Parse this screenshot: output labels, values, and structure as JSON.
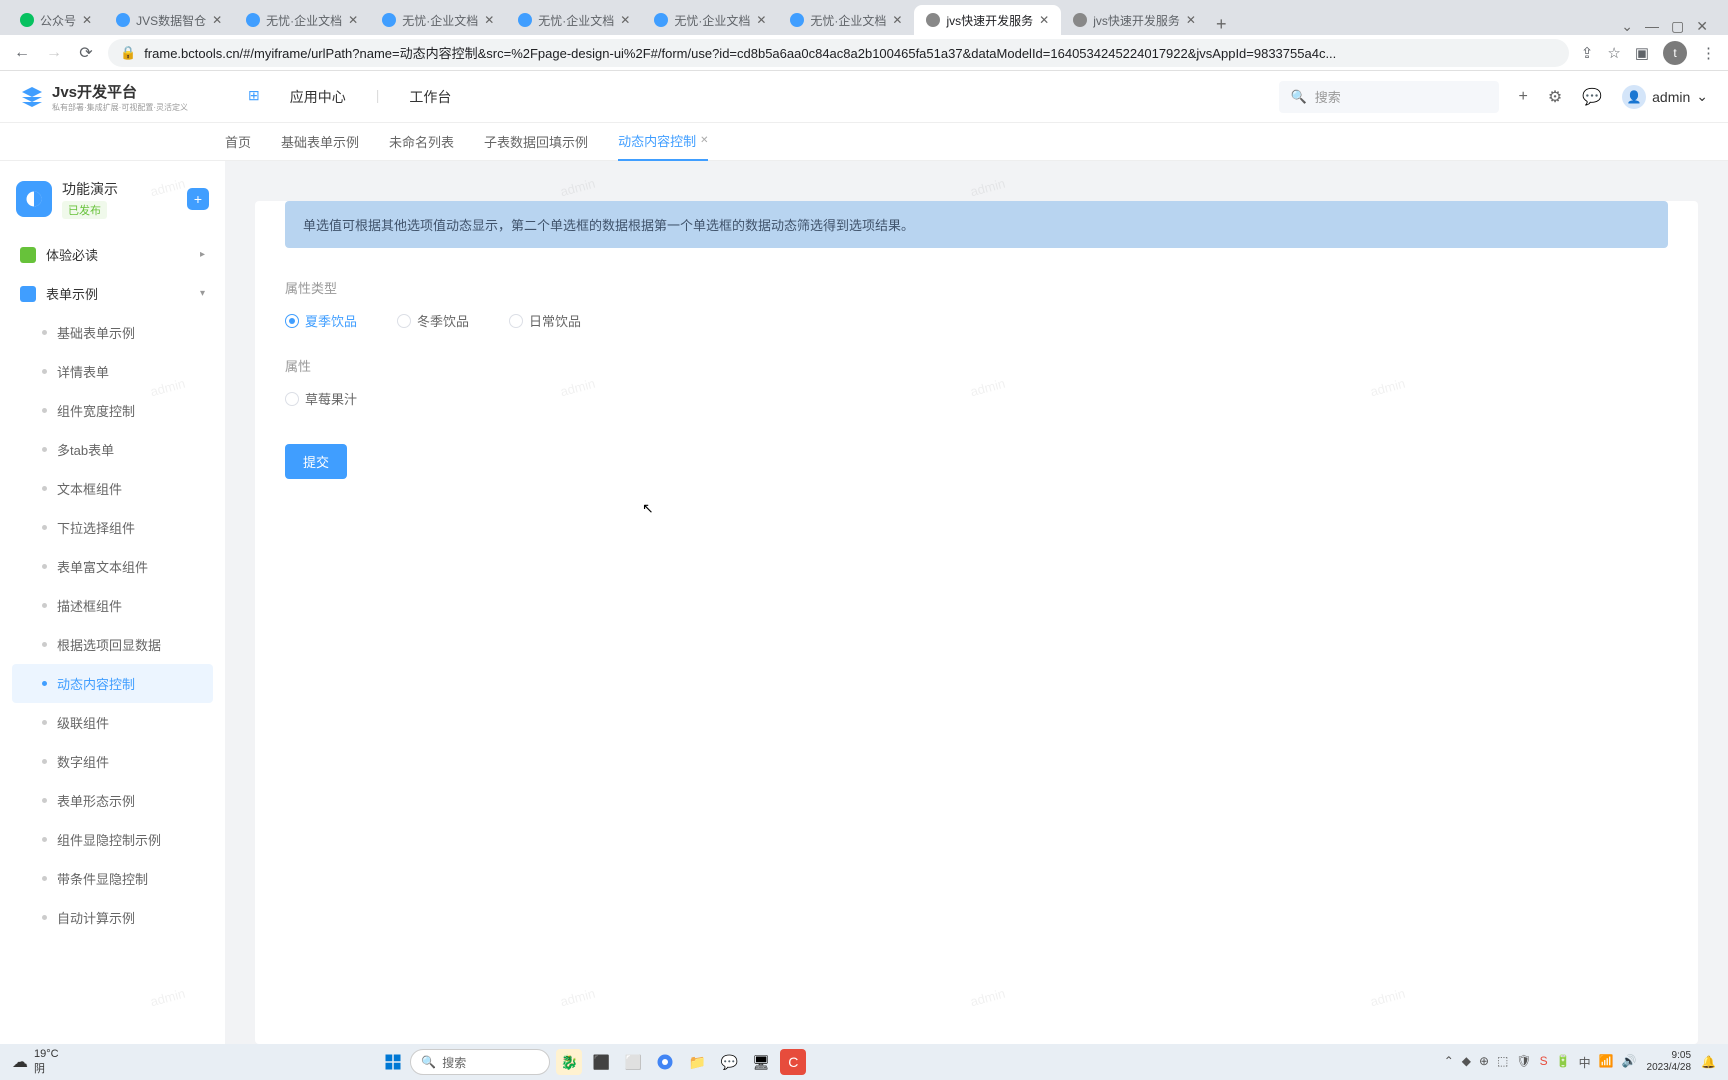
{
  "browser": {
    "tabs": [
      {
        "icon": "#07c160",
        "title": "公众号"
      },
      {
        "icon": "#409eff",
        "title": "JVS数据智仓"
      },
      {
        "icon": "#409eff",
        "title": "无忧·企业文档"
      },
      {
        "icon": "#409eff",
        "title": "无忧·企业文档"
      },
      {
        "icon": "#409eff",
        "title": "无忧·企业文档"
      },
      {
        "icon": "#409eff",
        "title": "无忧·企业文档"
      },
      {
        "icon": "#409eff",
        "title": "无忧·企业文档"
      },
      {
        "icon": "#888",
        "title": "jvs快速开发服务",
        "active": true
      },
      {
        "icon": "#888",
        "title": "jvs快速开发服务"
      }
    ],
    "url": "frame.bctools.cn/#/myiframe/urlPath?name=动态内容控制&src=%2Fpage-design-ui%2F#/form/use?id=cd8b5a6aa0c84ac8a2b100465fa51a37&dataModelId=1640534245224017922&jvsAppId=9833755a4c..."
  },
  "header": {
    "logo_title": "Jvs开发平台",
    "logo_sub": "私有部署·集成扩展·可视配置·灵活定义",
    "nav": [
      "应用中心",
      "工作台"
    ],
    "search_placeholder": "搜索",
    "user": "admin"
  },
  "tabs": [
    {
      "label": "首页"
    },
    {
      "label": "基础表单示例"
    },
    {
      "label": "未命名列表"
    },
    {
      "label": "子表数据回填示例"
    },
    {
      "label": "动态内容控制",
      "active": true
    }
  ],
  "sidebar": {
    "app_name": "功能演示",
    "app_status": "已发布",
    "groups": [
      {
        "icon": "#67c23a",
        "label": "体验必读",
        "chevron": "▸"
      },
      {
        "icon": "#409eff",
        "label": "表单示例",
        "chevron": "▾"
      }
    ],
    "items": [
      {
        "label": "基础表单示例"
      },
      {
        "label": "详情表单"
      },
      {
        "label": "组件宽度控制"
      },
      {
        "label": "多tab表单"
      },
      {
        "label": "文本框组件"
      },
      {
        "label": "下拉选择组件"
      },
      {
        "label": "表单富文本组件"
      },
      {
        "label": "描述框组件"
      },
      {
        "label": "根据选项回显数据"
      },
      {
        "label": "动态内容控制",
        "active": true
      },
      {
        "label": "级联组件"
      },
      {
        "label": "数字组件"
      },
      {
        "label": "表单形态示例"
      },
      {
        "label": "组件显隐控制示例"
      },
      {
        "label": "带条件显隐控制"
      },
      {
        "label": "自动计算示例"
      }
    ]
  },
  "form": {
    "banner": "单选值可根据其他选项值动态显示，第二个单选框的数据根据第一个单选框的数据动态筛选得到选项结果。",
    "label1": "属性类型",
    "radio1": [
      {
        "label": "夏季饮品",
        "selected": true
      },
      {
        "label": "冬季饮品"
      },
      {
        "label": "日常饮品"
      }
    ],
    "label2": "属性",
    "radio2": [
      {
        "label": "草莓果汁"
      }
    ],
    "submit": "提交"
  },
  "taskbar": {
    "weather_temp": "19°C",
    "weather_cond": "阴",
    "search_placeholder": "搜索",
    "time": "9:05",
    "date": "2023/4/28"
  },
  "watermark": "admin"
}
